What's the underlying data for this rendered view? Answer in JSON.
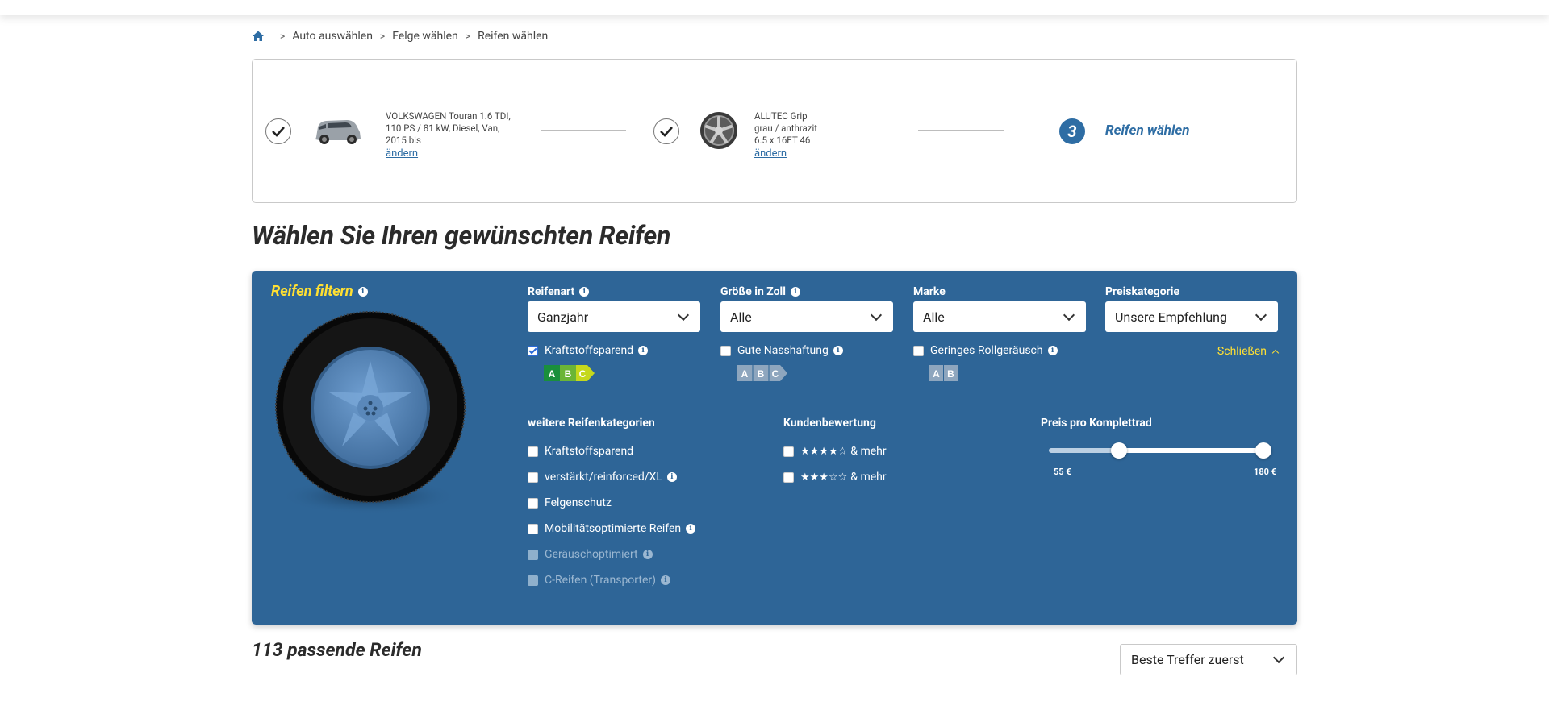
{
  "breadcrumb": {
    "items": [
      "Auto auswählen",
      "Felge wählen",
      "Reifen wählen"
    ],
    "separator": ">"
  },
  "stepper": {
    "car": {
      "line1": "VOLKSWAGEN Touran 1.6 TDI,",
      "line2": "110 PS / 81 kW, Diesel, Van,",
      "line3": "2015 bis",
      "change": "ändern"
    },
    "rim": {
      "line1": "ALUTEC Grip",
      "line2": "grau / anthrazit",
      "line3": "6.5 x 16ET 46",
      "change": "ändern"
    },
    "current": {
      "number": "3",
      "label": "Reifen wählen"
    }
  },
  "page_title": "Wählen Sie Ihren gewünschten Reifen",
  "filter": {
    "title": "Reifen filtern",
    "selects": [
      {
        "label": "Reifenart",
        "value": "Ganzjahr",
        "info": true
      },
      {
        "label": "Größe in Zoll",
        "value": "Alle",
        "info": true
      },
      {
        "label": "Marke",
        "value": "Alle",
        "info": false
      },
      {
        "label": "Preiskategorie",
        "value": "Unsere Empfehlung",
        "info": false
      }
    ],
    "label_checks": [
      {
        "label": "Kraftstoffsparend",
        "checked": true,
        "grades": [
          "A",
          "B",
          "C"
        ]
      },
      {
        "label": "Gute Nasshaftung",
        "checked": false,
        "grades": [
          "A",
          "B",
          "C"
        ]
      },
      {
        "label": "Geringes Rollgeräusch",
        "checked": false,
        "grades": [
          "A",
          "B"
        ]
      }
    ],
    "close_label": "Schließen",
    "more_categories": {
      "title": "weitere Reifenkategorien",
      "items": [
        {
          "label": "Kraftstoffsparend",
          "info": false,
          "disabled": false
        },
        {
          "label": "verstärkt/reinforced/XL",
          "info": true,
          "disabled": false
        },
        {
          "label": "Felgenschutz",
          "info": false,
          "disabled": false
        },
        {
          "label": "Mobilitätsoptimierte Reifen",
          "info": true,
          "disabled": false
        },
        {
          "label": "Geräuschoptimiert",
          "info": true,
          "disabled": true
        },
        {
          "label": "C-Reifen (Transporter)",
          "info": true,
          "disabled": true
        }
      ]
    },
    "rating": {
      "title": "Kundenbewertung",
      "items": [
        {
          "stars": "★★★★☆",
          "suffix": "& mehr"
        },
        {
          "stars": "★★★☆☆",
          "suffix": "& mehr"
        }
      ]
    },
    "price": {
      "title": "Preis pro Komplettrad",
      "min_label": "55 €",
      "max_label": "180 €",
      "min_fraction": 0.3,
      "max_fraction": 1.0
    }
  },
  "results": {
    "count_label": "113 passende Reifen",
    "sort_value": "Beste Treffer zuerst"
  },
  "colors": {
    "panel": "#2e6597",
    "accent_yellow": "#ffe033",
    "link_blue": "#2e6da4",
    "grade_A": "#1a8f3c",
    "grade_B": "#6bb536",
    "grade_C": "#c5d81c",
    "grade_gray": "#8ea6be"
  }
}
